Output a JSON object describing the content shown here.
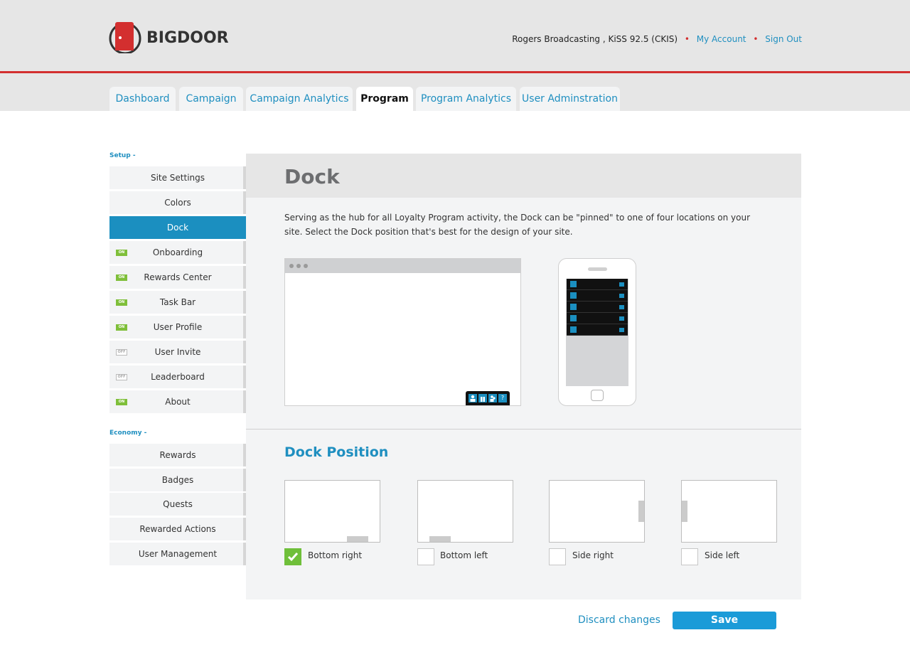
{
  "brand": {
    "name": "BIGDOOR"
  },
  "account": {
    "company": "Rogers Broadcasting , KiSS 92.5 (CKIS)",
    "my_account": "My Account",
    "sign_out": "Sign Out"
  },
  "tabs": [
    {
      "label": "Dashboard",
      "active": false
    },
    {
      "label": "Campaign",
      "active": false
    },
    {
      "label": "Campaign Analytics",
      "active": false
    },
    {
      "label": "Program",
      "active": true
    },
    {
      "label": "Program Analytics",
      "active": false
    },
    {
      "label": "User Adminstration",
      "active": false
    }
  ],
  "sidebar": {
    "setup_label": "Setup -",
    "setup_items": [
      {
        "label": "Site Settings",
        "badge": ""
      },
      {
        "label": "Colors",
        "badge": ""
      },
      {
        "label": "Dock",
        "badge": "",
        "active": true
      },
      {
        "label": "Onboarding",
        "badge": "ON"
      },
      {
        "label": "Rewards Center",
        "badge": "ON"
      },
      {
        "label": "Task Bar",
        "badge": "ON"
      },
      {
        "label": "User Profile",
        "badge": "ON"
      },
      {
        "label": "User Invite",
        "badge": "OFF"
      },
      {
        "label": "Leaderboard",
        "badge": "OFF"
      },
      {
        "label": "About",
        "badge": "ON"
      }
    ],
    "economy_label": "Economy -",
    "economy_items": [
      {
        "label": "Rewards"
      },
      {
        "label": "Badges"
      },
      {
        "label": "Quests"
      },
      {
        "label": "Rewarded Actions"
      },
      {
        "label": "User Management"
      }
    ]
  },
  "main": {
    "title": "Dock",
    "description": "Serving as the hub for all Loyalty Program activity, the Dock can be \"pinned\" to one of four locations on your site. Select the Dock position that's best for the design of your site.",
    "dock_buttons": [
      "user-icon",
      "gift-icon",
      "group-icon",
      "help-icon"
    ],
    "phone_rows": [
      {
        "icon": "user-icon"
      },
      {
        "icon": "gift-icon"
      },
      {
        "icon": "group-icon"
      },
      {
        "icon": "trophy-icon"
      },
      {
        "icon": "help-icon"
      }
    ],
    "dock_position_title": "Dock Position",
    "options": [
      {
        "label": "Bottom right",
        "checked": true
      },
      {
        "label": "Bottom left",
        "checked": false
      },
      {
        "label": "Side right",
        "checked": false
      },
      {
        "label": "Side left",
        "checked": false
      }
    ]
  },
  "actions": {
    "discard": "Discard changes",
    "save": "Save"
  },
  "colors": {
    "accent": "#1f8fc0",
    "brand_red": "#d32f2f",
    "on_badge": "#7fbf3a",
    "save_button": "#1b9bd8"
  }
}
